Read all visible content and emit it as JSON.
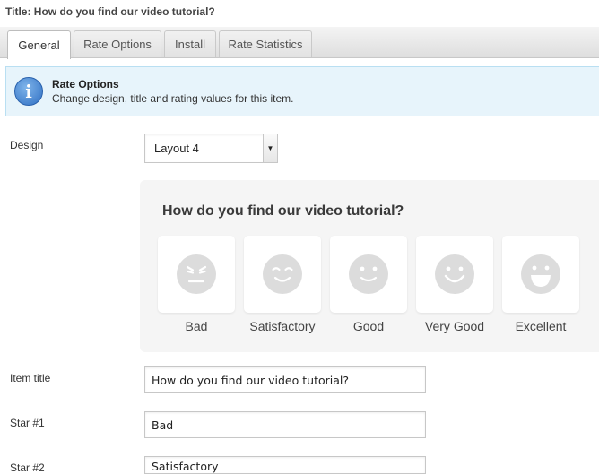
{
  "header": {
    "title": "Title: How do you find our video tutorial?"
  },
  "tabs": [
    {
      "label": "General",
      "active": true
    },
    {
      "label": "Rate Options",
      "active": false
    },
    {
      "label": "Install",
      "active": false
    },
    {
      "label": "Rate Statistics",
      "active": false
    }
  ],
  "info": {
    "icon": "info-icon",
    "title": "Rate Options",
    "text": "Change design, title and rating values for this item."
  },
  "design": {
    "label": "Design",
    "selected": "Layout 4"
  },
  "preview": {
    "title": "How do you find our video tutorial?",
    "faces": [
      {
        "label": "Bad",
        "icon": "angry-face-icon"
      },
      {
        "label": "Satisfactory",
        "icon": "smirk-face-icon"
      },
      {
        "label": "Good",
        "icon": "smile-face-icon"
      },
      {
        "label": "Very Good",
        "icon": "happy-face-icon"
      },
      {
        "label": "Excellent",
        "icon": "grin-face-icon"
      }
    ],
    "face_color": "#dcdcdc"
  },
  "fields": {
    "item_title": {
      "label": "Item title",
      "value": "How do you find our video tutorial?"
    },
    "star1": {
      "label": "Star #1",
      "value": "Bad"
    },
    "star2": {
      "label": "Star #2",
      "value": "Satisfactory"
    }
  }
}
